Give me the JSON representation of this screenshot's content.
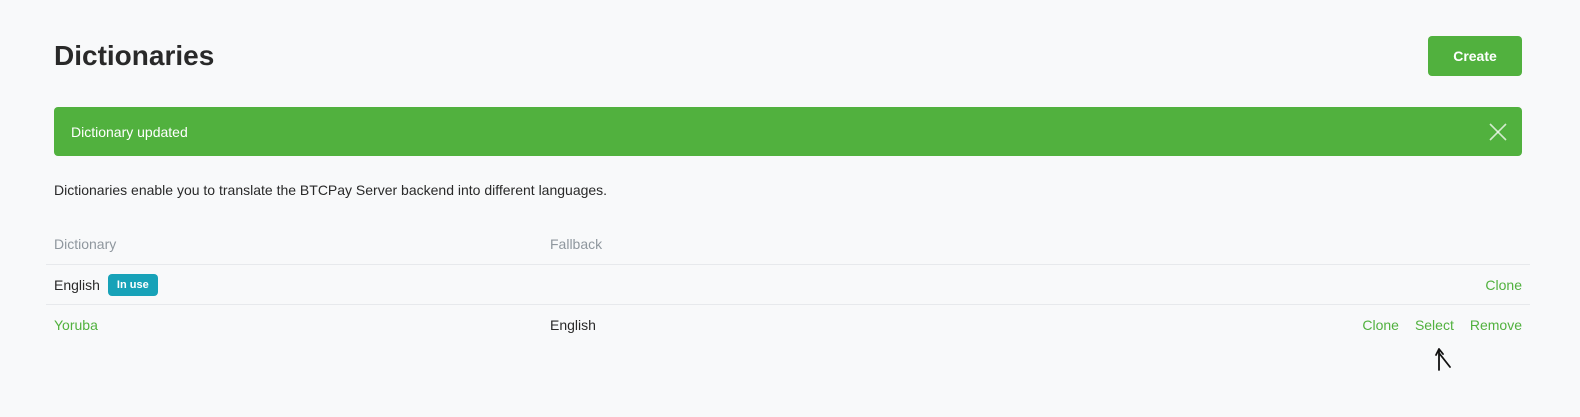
{
  "header": {
    "title": "Dictionaries",
    "create_label": "Create"
  },
  "alert": {
    "message": "Dictionary updated"
  },
  "description": "Dictionaries enable you to translate the BTCPay Server backend into different languages.",
  "table": {
    "columns": [
      "Dictionary",
      "Fallback"
    ],
    "rows": [
      {
        "dictionary": "English",
        "badge": "In use",
        "fallback": "",
        "actions": [
          "Clone"
        ]
      },
      {
        "dictionary": "Yoruba",
        "fallback": "English",
        "actions": [
          "Clone",
          "Select",
          "Remove"
        ]
      }
    ]
  },
  "colors": {
    "accent": "#51b13e",
    "badge": "#17a2b8",
    "background": "#f8f9fa"
  },
  "icons": {
    "close": "close-icon",
    "cursor": "cursor-icon"
  }
}
